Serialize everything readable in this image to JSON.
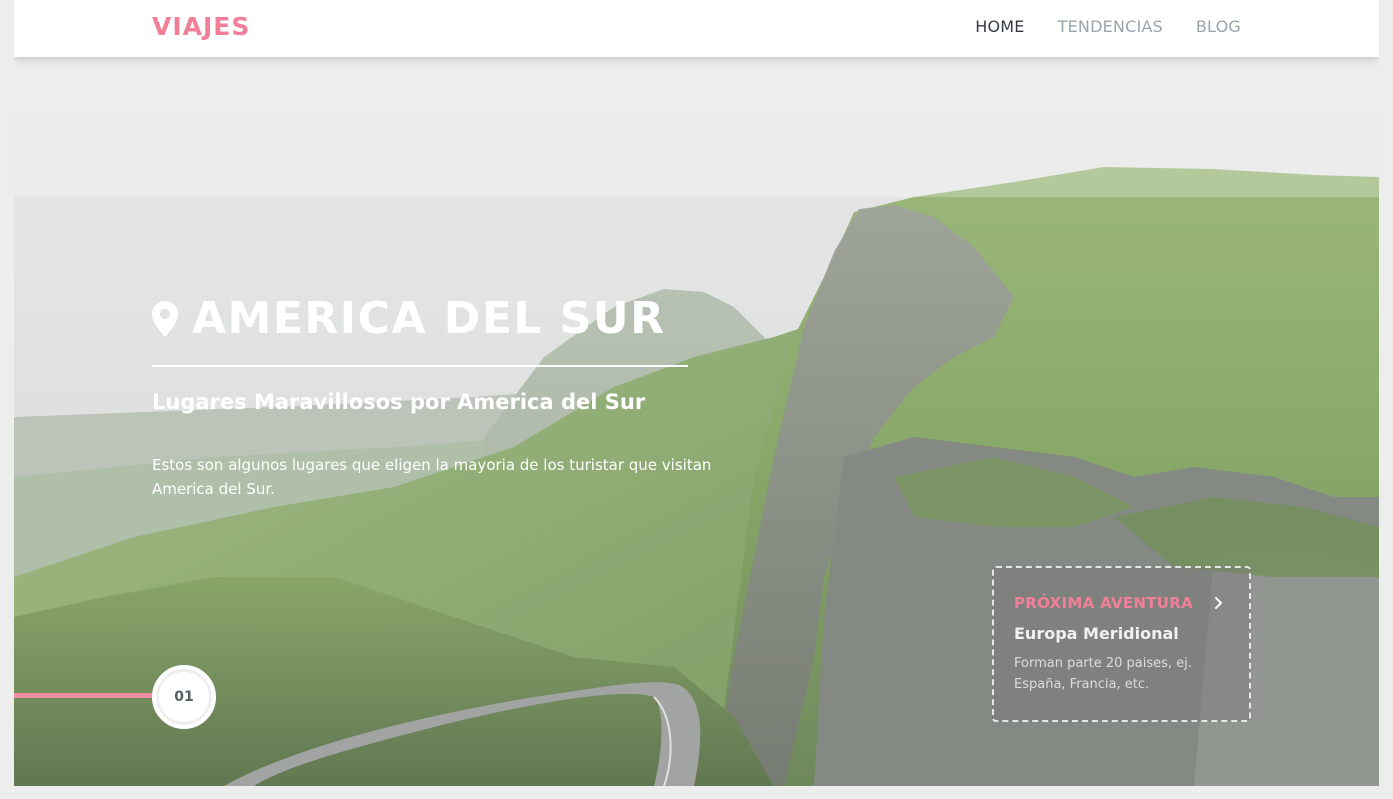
{
  "brand": {
    "name": "VIAJES"
  },
  "nav": {
    "items": [
      {
        "label": "HOME",
        "active": true
      },
      {
        "label": "TENDENCIAS",
        "active": false
      },
      {
        "label": "BLOG",
        "active": false
      }
    ]
  },
  "hero": {
    "icon": "map-pin-icon",
    "title": "AMERICA DEL SUR",
    "subtitle": "Lugares Maravillosos por America del Sur",
    "description": "Estos son algunos lugares que eligen la mayoria de los turistar que visitan America del Sur.",
    "slide_number": "01"
  },
  "next_adventure": {
    "label": "PRÓXIMA AVENTURA",
    "icon": "chevron-right-icon",
    "name": "Europa Meridional",
    "description": "Forman parte 20 paises, ej. España, Francia, etc."
  },
  "colors": {
    "accent": "#f27f98",
    "nav_active": "#333b44",
    "nav_inactive": "#9aa4ad"
  }
}
